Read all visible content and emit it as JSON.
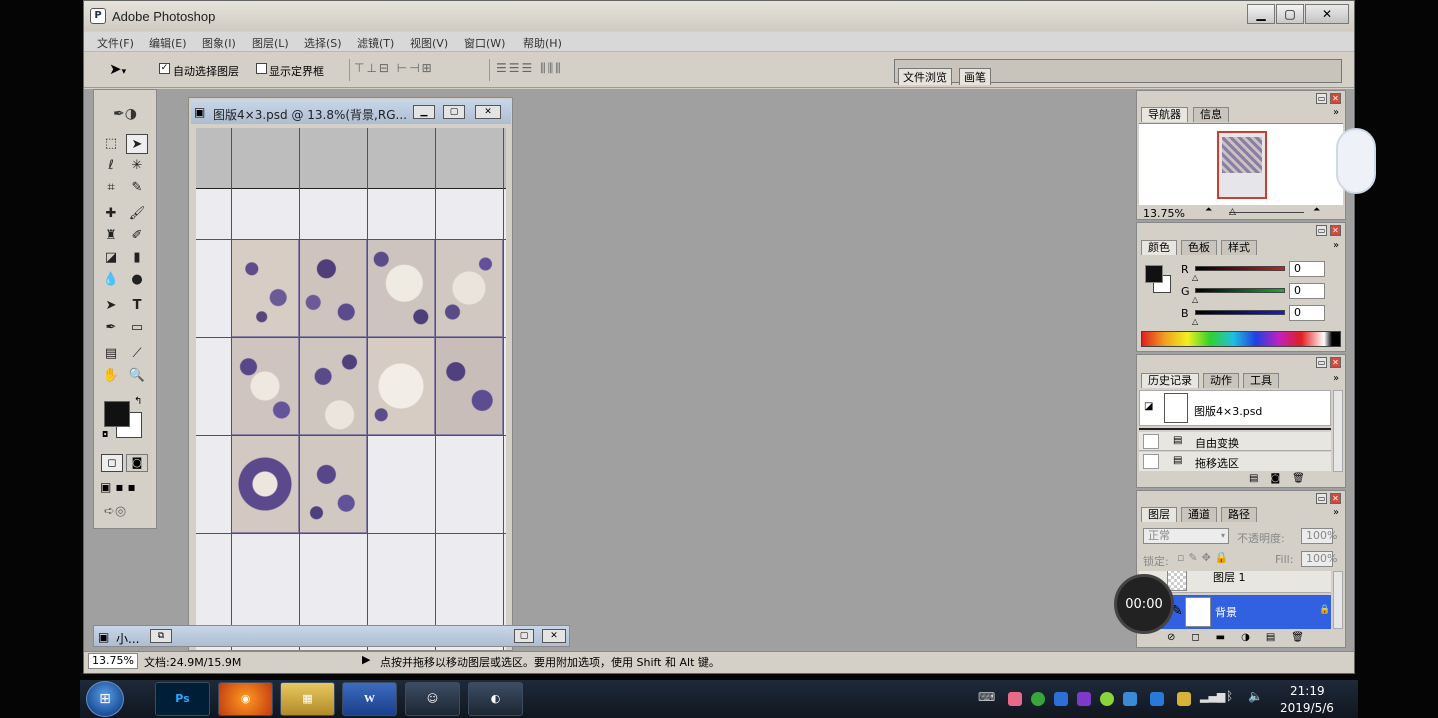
{
  "app": {
    "title": "Adobe Photoshop",
    "icon_glyph": "P"
  },
  "window_controls": {
    "minimize": "▁",
    "maximize": "▢",
    "close": "✕"
  },
  "menu": [
    "文件(F)",
    "编辑(E)",
    "图象(I)",
    "图层(L)",
    "选择(S)",
    "滤镜(T)",
    "视图(V)",
    "窗口(W)",
    "帮助(H)"
  ],
  "options": {
    "auto_select_layer": "自动选择图层",
    "show_bounding_box": "显示定界框",
    "palette_tabs": [
      "文件浏览",
      "画笔"
    ]
  },
  "document": {
    "title": "图版4×3.psd @ 13.8%(背景,RG...",
    "zoom": "13.75%",
    "doc_size": "文档:24.9M/15.9M",
    "status_hint": "点按并拖移以移动图层或选区。要用附加选项，使用 Shift 和 Alt 键。"
  },
  "minimized_doc": {
    "title": "小..."
  },
  "navigator": {
    "tabs": [
      "导航器",
      "信息"
    ],
    "zoom": "13.75%"
  },
  "color_panel": {
    "tabs": [
      "颜色",
      "色板",
      "样式"
    ],
    "channels": [
      {
        "label": "R",
        "value": "0",
        "color": "#c8201e"
      },
      {
        "label": "G",
        "value": "0",
        "color": "#1fa637"
      },
      {
        "label": "B",
        "value": "0",
        "color": "#1a1ad0"
      }
    ]
  },
  "history": {
    "tabs": [
      "历史记录",
      "动作",
      "工具"
    ],
    "snapshot": "图版4×3.psd",
    "items": [
      "自由变换",
      "拖移选区"
    ]
  },
  "layers": {
    "tabs": [
      "图层",
      "通道",
      "路径"
    ],
    "blend_mode": "正常",
    "opacity_label": "不透明度:",
    "opacity_value": "100%",
    "lock_label": "锁定:",
    "fill_label": "Fill:",
    "fill_value": "100%",
    "items": [
      {
        "name": "图层 1",
        "selected": false
      },
      {
        "name": "背景",
        "selected": true
      }
    ]
  },
  "recording_timer": "00:00",
  "taskbar": {
    "apps": [
      "Ps",
      "Firefox",
      "Explorer",
      "W",
      "QQ",
      "Screen"
    ],
    "time": "21:19",
    "date": "2019/5/6"
  }
}
